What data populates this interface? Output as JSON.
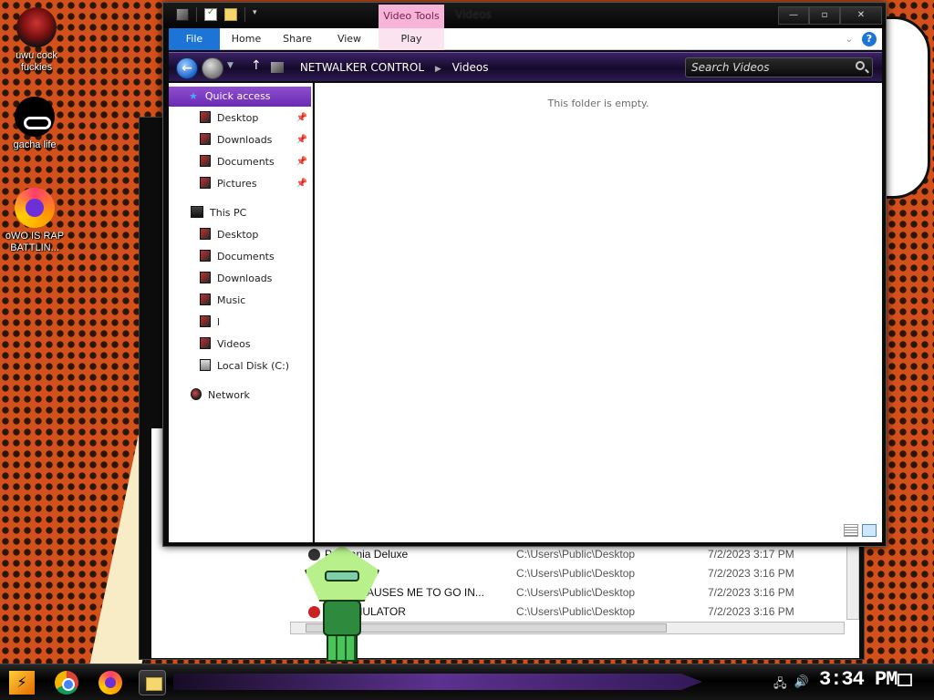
{
  "desktop": {
    "icons": [
      {
        "label": "uwu cock fuckies",
        "icon": "helmet-icon"
      },
      {
        "label": "gacha life",
        "icon": "incognito-icon"
      },
      {
        "label": "oWO IS RAP BATTLIN...",
        "icon": "firefox-icon"
      }
    ]
  },
  "explorer": {
    "title": "Videos",
    "context_tab": "Video Tools",
    "ribbon_tabs": [
      "File",
      "Home",
      "Share",
      "View",
      "Play"
    ],
    "address": [
      "NETWALKER CONTROL",
      "Videos"
    ],
    "search_placeholder": "Search Videos",
    "empty_message": "This folder is empty.",
    "quick_access": {
      "label": "Quick access",
      "items": [
        "Desktop",
        "Downloads",
        "Documents",
        "Pictures"
      ]
    },
    "this_pc": {
      "label": "This PC",
      "items": [
        "Desktop",
        "Documents",
        "Downloads",
        "Music",
        "l",
        "Videos",
        "Local Disk (C:)"
      ]
    },
    "network": "Network"
  },
  "background_window": {
    "rows": [
      {
        "name": "P  t Mania Deluxe",
        "path": "C:\\Users\\Public\\Desktop",
        "date": "7/2/2023 3:17 PM"
      },
      {
        "name": "          R",
        "path": "C:\\Users\\Public\\Desktop",
        "date": "7/2/2023 3:16 PM"
      },
      {
        "name": "      UAGE CAUSES ME TO GO IN...",
        "path": "C:\\Users\\Public\\Desktop",
        "date": "7/2/2023 3:16 PM"
      },
      {
        "name": "      NE SIMULATOR",
        "path": "C:\\Users\\Public\\Desktop",
        "date": "7/2/2023 3:16 PM"
      }
    ]
  },
  "taskbar": {
    "clock": "3:34 PM",
    "apps": [
      "chrome-icon",
      "firefox-icon",
      "file-explorer-icon"
    ]
  },
  "colors": {
    "accent_purple": "#7a3fc4",
    "file_tab_blue": "#1b74d6",
    "video_tools_pink": "#f5b4d8",
    "desktop_orange": "#d4501a"
  }
}
